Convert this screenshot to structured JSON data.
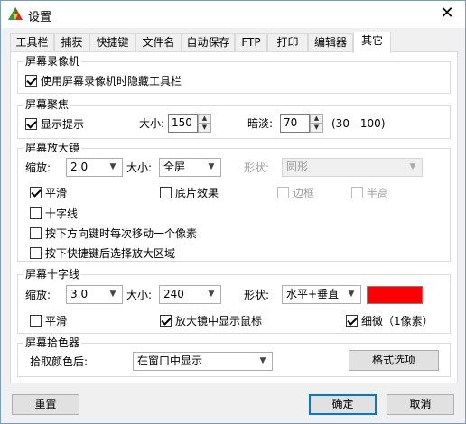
{
  "window": {
    "title": "设置",
    "close_glyph": "✕"
  },
  "tabs": [
    "工具栏",
    "捕获",
    "快捷键",
    "文件名",
    "自动保存",
    "FTP",
    "打印",
    "编辑器",
    "其它"
  ],
  "active_tab": "其它",
  "recorder": {
    "title": "屏幕录像机",
    "hide_toolbar_label": "使用屏幕录像机时隐藏工具栏",
    "hide_toolbar_checked": true
  },
  "focus": {
    "title": "屏幕聚焦",
    "show_hint_label": "显示提示",
    "show_hint_checked": true,
    "size_label": "大小:",
    "size_value": "150",
    "dim_label": "暗淡:",
    "dim_value": "70",
    "dim_range": "(30 - 100)"
  },
  "magnifier": {
    "title": "屏幕放大镜",
    "zoom_label": "缩放:",
    "zoom_value": "2.0",
    "size_label": "大小:",
    "size_value": "全屏",
    "shape_label": "形状:",
    "shape_value": "圆形",
    "smooth_label": "平滑",
    "smooth_checked": true,
    "negative_label": "底片效果",
    "negative_checked": false,
    "border_label": "边框",
    "border_checked": false,
    "half_height_label": "半高",
    "half_height_checked": false,
    "crosshair_label": "十字线",
    "crosshair_checked": false,
    "arrow_step_label": "按下方向键时每次移动一个像素",
    "arrow_step_checked": false,
    "hotkey_select_label": "按下快捷键后选择放大区域",
    "hotkey_select_checked": false
  },
  "crosshair": {
    "title": "屏幕十字线",
    "zoom_label": "缩放:",
    "zoom_value": "3.0",
    "size_label": "大小:",
    "size_value": "240",
    "shape_label": "形状:",
    "shape_value": "水平+垂直",
    "color": "#ff0000",
    "smooth_label": "平滑",
    "smooth_checked": false,
    "show_cursor_label": "放大镜中显示鼠标",
    "show_cursor_checked": true,
    "fine_label": "细微（1像素）",
    "fine_checked": true
  },
  "picker": {
    "title": "屏幕拾色器",
    "after_pick_label": "拾取颜色后:",
    "after_pick_value": "在窗口中显示",
    "format_button": "格式选项"
  },
  "buttons": {
    "reset": "重置",
    "ok": "确定",
    "cancel": "取消"
  }
}
